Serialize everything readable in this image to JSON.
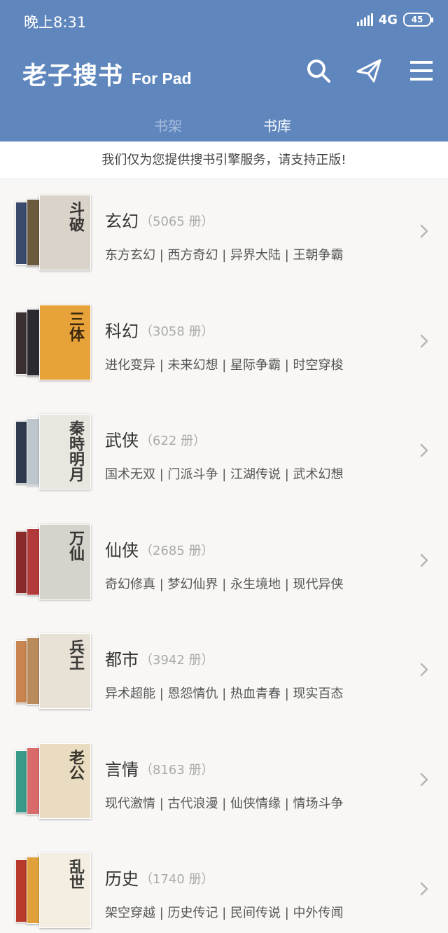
{
  "status": {
    "time": "晚上8:31",
    "network": "4G",
    "battery": "45"
  },
  "header": {
    "title": "老子搜书",
    "subtitle": "For Pad"
  },
  "tabs": [
    {
      "label": "书架",
      "active": false
    },
    {
      "label": "书库",
      "active": true
    }
  ],
  "notice": "我们仅为您提供搜书引擎服务，请支持正版!",
  "categories": [
    {
      "name": "玄幻",
      "count": "（5065 册）",
      "tags": "东方玄幻 | 西方奇幻 | 异界大陆 | 王朝争霸",
      "cover_colors": [
        "#3a4a6a",
        "#6b5a3e",
        "#d9d3c9"
      ],
      "front_text": "斗破"
    },
    {
      "name": "科幻",
      "count": "（3058 册）",
      "tags": "进化变异 | 未来幻想 | 星际争霸 | 时空穿梭",
      "cover_colors": [
        "#3a3030",
        "#2a2a30",
        "#e8a23a"
      ],
      "front_text": "三体"
    },
    {
      "name": "武侠",
      "count": "（622 册）",
      "tags": "国术无双 | 门派斗争 | 江湖传说 | 武术幻想",
      "cover_colors": [
        "#2f3a4f",
        "#bcc6cc",
        "#e9e6e0"
      ],
      "front_text": "秦時明月"
    },
    {
      "name": "仙侠",
      "count": "（2685 册）",
      "tags": "奇幻修真 | 梦幻仙界 | 永生境地 | 现代异侠",
      "cover_colors": [
        "#8a2a2a",
        "#b33a3a",
        "#d6d2cc"
      ],
      "front_text": "万仙"
    },
    {
      "name": "都市",
      "count": "（3942 册）",
      "tags": "异术超能 | 恩怨情仇 | 热血青春 | 现实百态",
      "cover_colors": [
        "#c8854f",
        "#b98a5c",
        "#e7e1d6"
      ],
      "front_text": "兵王"
    },
    {
      "name": "言情",
      "count": "（8163 册）",
      "tags": "现代激情 | 古代浪漫 | 仙侠情缘 | 情场斗争",
      "cover_colors": [
        "#3a9a8a",
        "#d86a6a",
        "#e9dcc0"
      ],
      "front_text": "老公"
    },
    {
      "name": "历史",
      "count": "（1740 册）",
      "tags": "架空穿越 | 历史传记 | 民间传说 | 中外传闻",
      "cover_colors": [
        "#b83a2a",
        "#e0a03a",
        "#f3ede2"
      ],
      "front_text": "乱世"
    }
  ]
}
